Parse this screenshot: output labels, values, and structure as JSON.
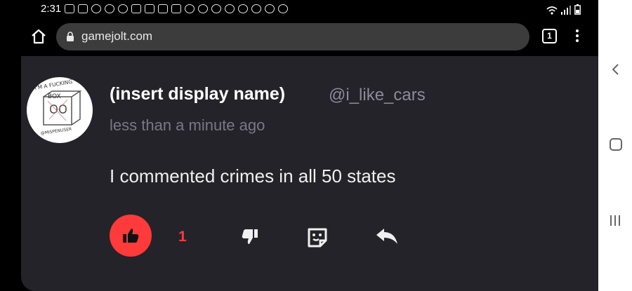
{
  "status_bar": {
    "time": "2:31",
    "icons": [
      "gallery-icon",
      "youtube-icon",
      "snapchat-icon",
      "voicemail-icon",
      "reddit-icon",
      "gmail-icon",
      "gallery-icon",
      "gmail-icon",
      "gmail-icon",
      "puzzle-icon",
      "app-icon",
      "app-icon",
      "person-icon",
      "person-icon",
      "missed-call-icon",
      "viber-icon",
      "viber-icon"
    ],
    "right_icons": [
      "wifi-icon",
      "signal-icon",
      "battery-icon"
    ]
  },
  "browser": {
    "url": "gamejolt.com",
    "tab_count": "1"
  },
  "post": {
    "avatar_text_top": "I'M A FUCKING",
    "avatar_text_box": "BOX",
    "avatar_text_bottom": "@MISPENUSER",
    "display_name": "(insert display name)",
    "username": "@i_like_cars",
    "timestamp": "less than a minute ago",
    "body": "I commented crimes in all 50 states",
    "like_count": "1"
  },
  "colors": {
    "accent": "#ff3a3a",
    "card_background": "#242329",
    "muted_text": "#8d8b96"
  }
}
